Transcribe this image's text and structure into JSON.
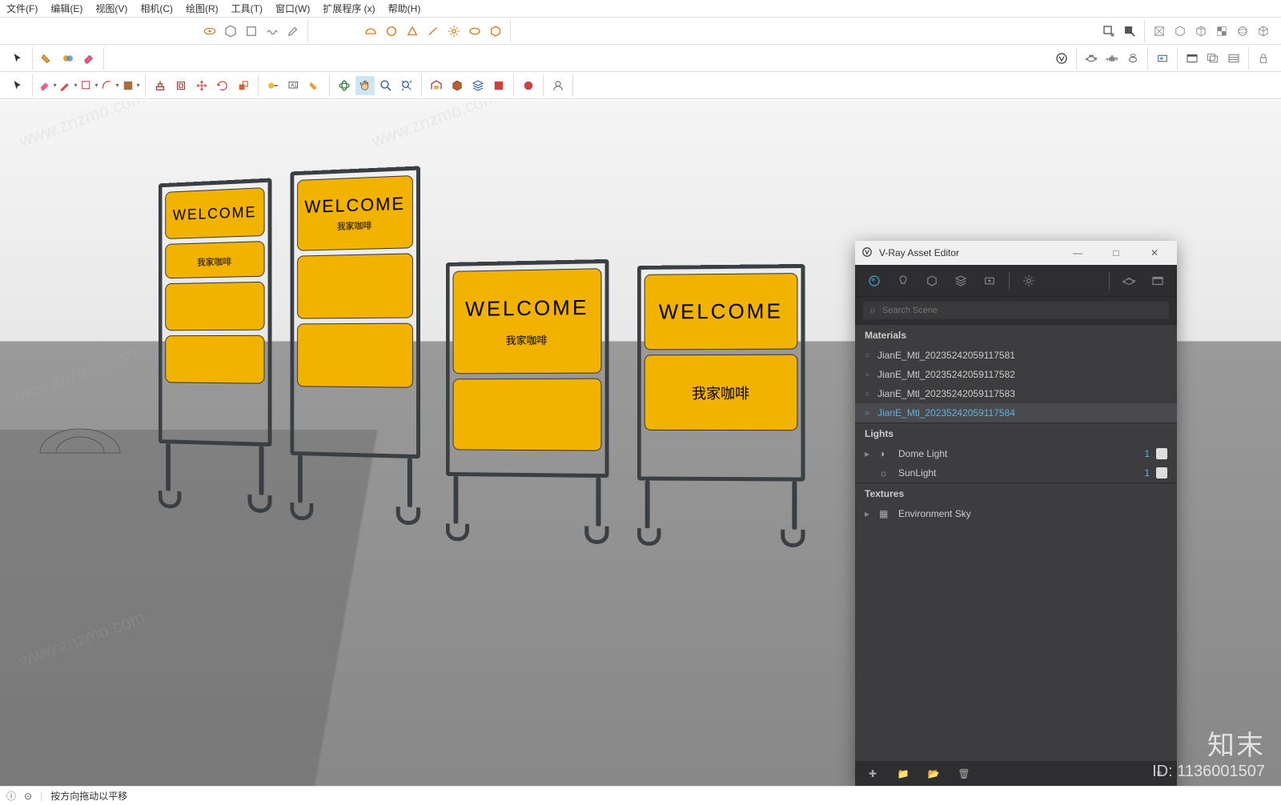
{
  "menu": {
    "file": "文件(F)",
    "edit": "编辑(E)",
    "view": "视图(V)",
    "camera": "相机(C)",
    "draw": "绘图(R)",
    "tools": "工具(T)",
    "window": "窗口(W)",
    "extensions": "扩展程序 (x)",
    "help": "帮助(H)"
  },
  "status": {
    "hint": "按方向拖动以平移"
  },
  "watermark": {
    "brand": "知末",
    "id_label": "ID:",
    "id_value": "1136001507",
    "diag": "www.znzmo.com"
  },
  "vray": {
    "title": "V-Ray Asset Editor",
    "search_placeholder": "Search Scene",
    "sections": {
      "materials": "Materials",
      "lights": "Lights",
      "textures": "Textures"
    },
    "materials": [
      "JianE_Mtl_20235242059117581",
      "JianE_Mtl_20235242059117582",
      "JianE_Mtl_20235242059117583",
      "JianE_Mtl_20235242059117584"
    ],
    "lights": [
      {
        "name": "Dome Light",
        "count": "1"
      },
      {
        "name": "SunLight",
        "count": "1"
      }
    ],
    "textures": [
      {
        "name": "Environment Sky"
      }
    ]
  },
  "signs": {
    "welcome": "WELCOME",
    "coffee": "我家咖啡"
  }
}
